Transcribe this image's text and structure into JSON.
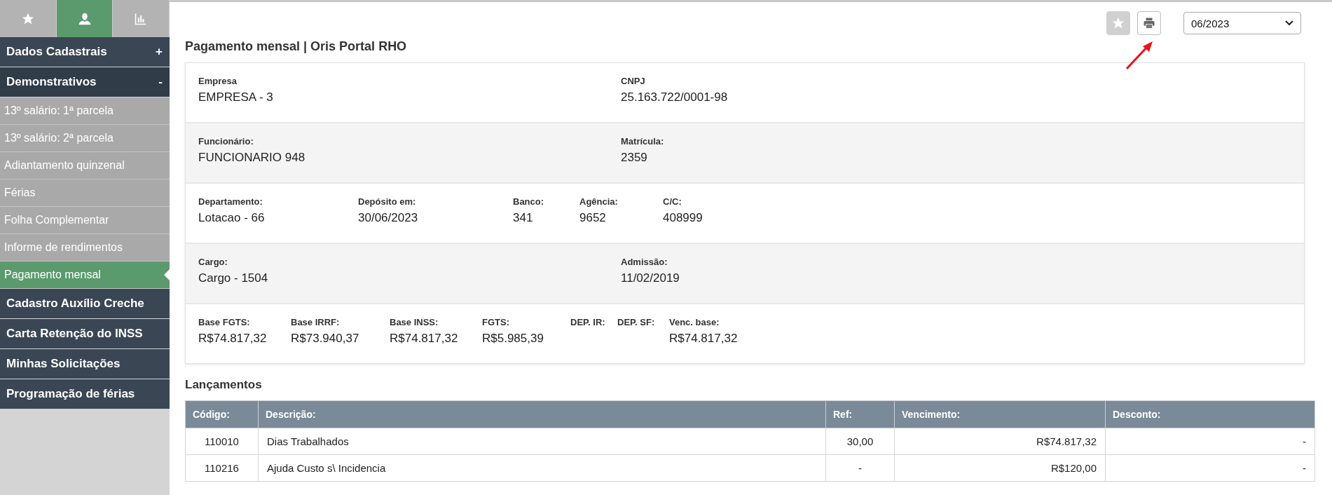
{
  "sidebar": {
    "tabs": [
      {
        "selected": false
      },
      {
        "selected": true
      },
      {
        "selected": false
      }
    ],
    "menu": [
      {
        "label": "Dados Cadastrais",
        "toggle": "+"
      },
      {
        "label": "Demonstrativos",
        "toggle": "-",
        "children": [
          {
            "label": "13º salário: 1ª parcela",
            "selected": false
          },
          {
            "label": "13º salário: 2ª parcela",
            "selected": false
          },
          {
            "label": "Adiantamento quinzenal",
            "selected": false
          },
          {
            "label": "Férias",
            "selected": false
          },
          {
            "label": "Folha Complementar",
            "selected": false
          },
          {
            "label": "Informe de rendimentos",
            "selected": false
          },
          {
            "label": "Pagamento mensal",
            "selected": true
          }
        ]
      },
      {
        "label": "Cadastro Auxílio Creche"
      },
      {
        "label": "Carta Retenção do INSS"
      },
      {
        "label": "Minhas Solicitações"
      },
      {
        "label": "Programação de férias"
      }
    ]
  },
  "toolbar": {
    "period": "06/2023"
  },
  "title": "Pagamento mensal | Oris Portal RHO",
  "info_card": {
    "rows": [
      {
        "kind": "pair",
        "fields": [
          {
            "label": "Empresa",
            "value": "EMPRESA - 3"
          },
          {
            "label": "CNPJ",
            "value": "25.163.722/0001-98"
          }
        ]
      },
      {
        "kind": "pair",
        "fields": [
          {
            "label": "Funcionário:",
            "value": "FUNCIONARIO 948"
          },
          {
            "label": "Matrícula:",
            "value": "2359"
          }
        ]
      },
      {
        "kind": "bank",
        "fields": [
          {
            "label": "Departamento:",
            "value": "Lotacao - 66"
          },
          {
            "label": "Depósito em:",
            "value": "30/06/2023"
          },
          {
            "label": "Banco:",
            "value": "341"
          },
          {
            "label": "Agência:",
            "value": "9652"
          },
          {
            "label": "C/C:",
            "value": "408999"
          }
        ]
      },
      {
        "kind": "pair",
        "fields": [
          {
            "label": "Cargo:",
            "value": "Cargo - 1504"
          },
          {
            "label": "Admissão:",
            "value": "11/02/2019"
          }
        ]
      },
      {
        "kind": "totals",
        "fields": [
          {
            "label": "Base FGTS:",
            "value": "R$74.817,32"
          },
          {
            "label": "Base IRRF:",
            "value": "R$73.940,37"
          },
          {
            "label": "Base INSS:",
            "value": "R$74.817,32"
          },
          {
            "label": "FGTS:",
            "value": "R$5.985,39"
          },
          {
            "label": "DEP. IR:"
          },
          {
            "label": "DEP. SF:"
          },
          {
            "label": "Venc. base:",
            "value": "R$74.817,32"
          }
        ]
      }
    ]
  },
  "entries": {
    "title": "Lançamentos",
    "columns": [
      "Código:",
      "Descrição:",
      "Ref:",
      "Vencimento:",
      "Desconto:"
    ],
    "rows": [
      [
        "110010",
        "Dias Trabalhados",
        "30,00",
        "R$74.817,32",
        "-"
      ],
      [
        "110216",
        "Ajuda Custo s\\ Incidencia",
        "-",
        "R$120,00",
        "-"
      ]
    ]
  }
}
